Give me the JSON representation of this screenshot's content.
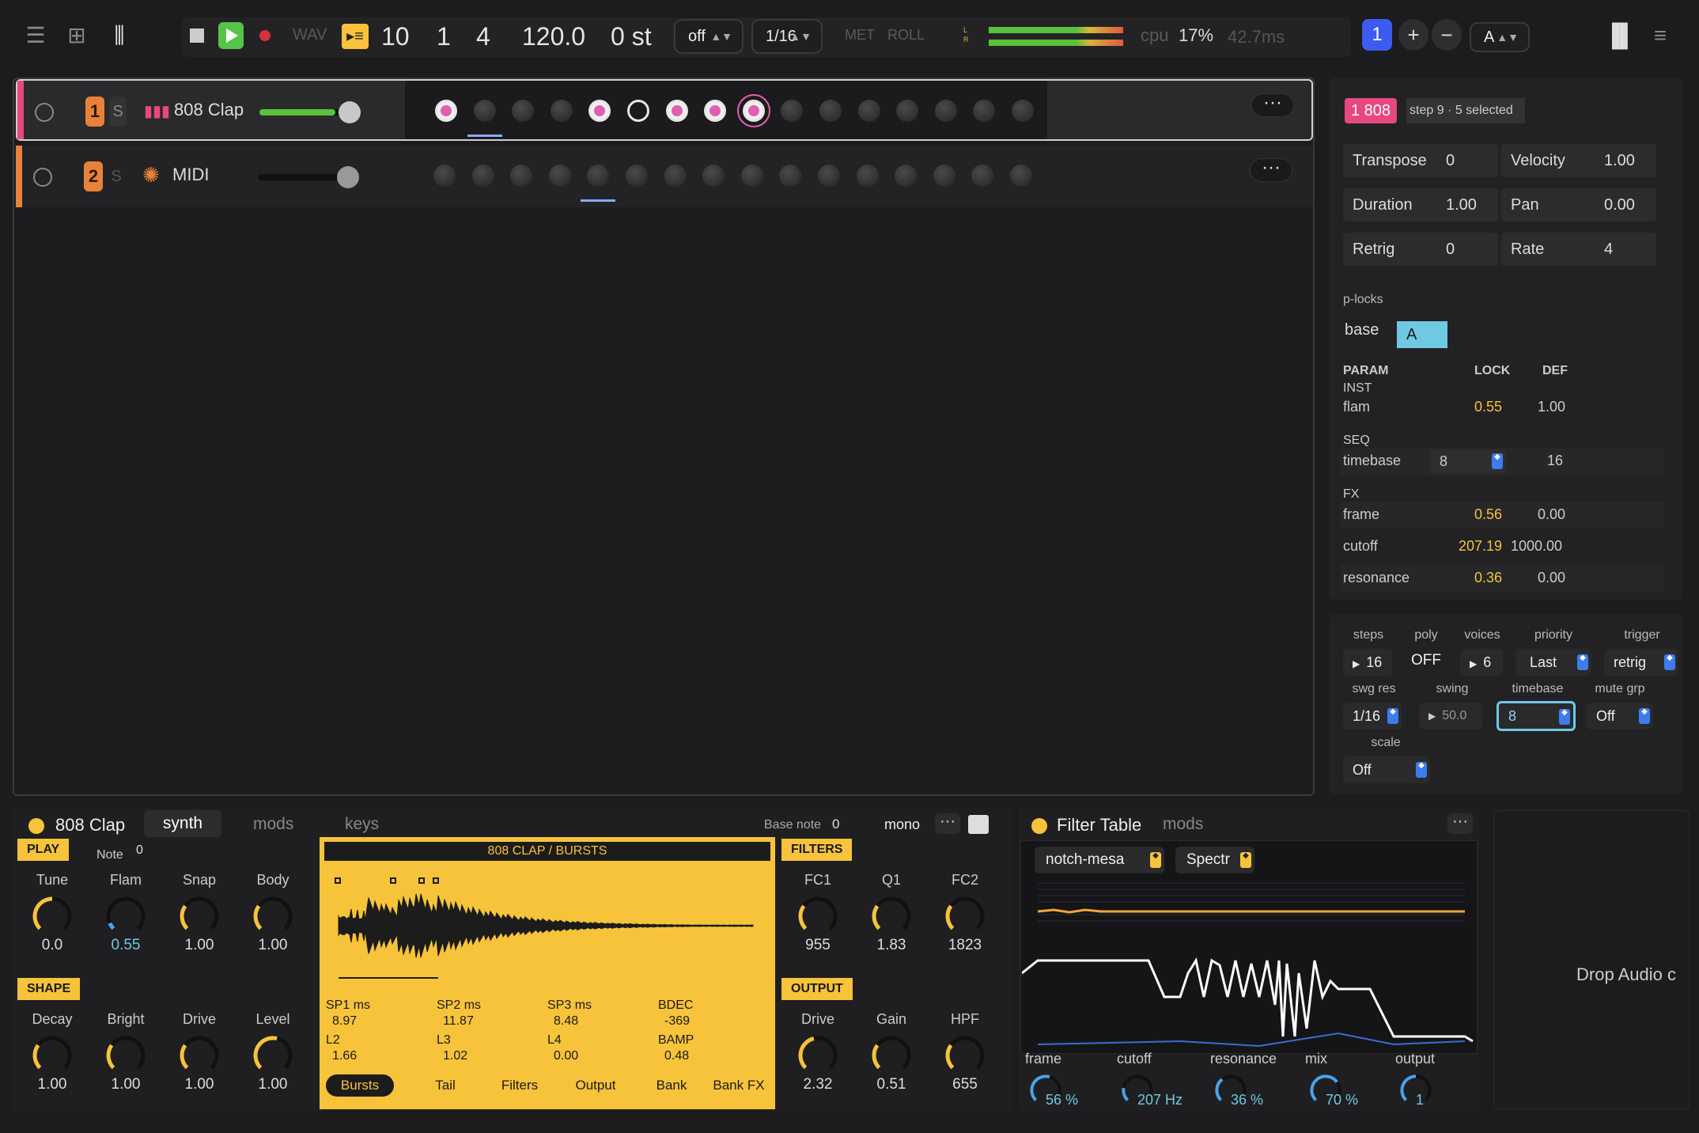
{
  "transport": {
    "wav": "WAV",
    "bar": "10",
    "beat": "1",
    "sub": "4",
    "tempo": "120.0",
    "semi": "0 st",
    "quant": "off",
    "grid": "1/16",
    "met": "MET",
    "roll": "ROLL",
    "cpu_label": "cpu",
    "cpu": "17%",
    "latency": "42.7ms",
    "pattern_num": "1",
    "plus": "+",
    "minus": "−",
    "bank": "A",
    "meter_l": "L",
    "meter_r": "R"
  },
  "tracks": [
    {
      "num": "1",
      "solo": "S",
      "name": "808 Clap",
      "color": "#e8487f",
      "fader": 0.7
    },
    {
      "num": "2",
      "solo": "S",
      "name": "MIDI",
      "color": "#e8823a",
      "fader": 0.78
    }
  ],
  "inspector": {
    "badge": "1 808",
    "step": "step 9",
    "selected": "· 5 selected",
    "params": [
      {
        "label": "Transpose",
        "value": "0"
      },
      {
        "label": "Velocity",
        "value": "1.00"
      },
      {
        "label": "Duration",
        "value": "1.00"
      },
      {
        "label": "Pan",
        "value": "0.00"
      },
      {
        "label": "Retrig",
        "value": "0"
      },
      {
        "label": "Rate",
        "value": "4"
      }
    ],
    "plocks_title": "p-locks",
    "base": "base",
    "base_val": "A",
    "col_param": "PARAM",
    "col_lock": "LOCK",
    "col_def": "DEF",
    "inst": "INST",
    "flam": "flam",
    "flam_lock": "0.55",
    "flam_def": "1.00",
    "seq": "SEQ",
    "timebase": "timebase",
    "timebase_lock": "8",
    "timebase_def": "16",
    "fx": "FX",
    "frame": "frame",
    "frame_lock": "0.56",
    "frame_def": "0.00",
    "cutoff": "cutoff",
    "cutoff_lock": "207.19",
    "cutoff_def": "1000.00",
    "resonance": "resonance",
    "res_lock": "0.36",
    "res_def": "0.00"
  },
  "track_settings": {
    "steps_l": "steps",
    "steps": "16",
    "poly_l": "poly",
    "poly": "OFF",
    "voices_l": "voices",
    "voices": "6",
    "priority_l": "priority",
    "priority": "Last",
    "trigger_l": "trigger",
    "trigger": "retrig",
    "swgres_l": "swg res",
    "swgres": "1/16",
    "swing_l": "swing",
    "swing": "50.0",
    "timebase_l": "timebase",
    "timebase": "8",
    "mutegrp_l": "mute grp",
    "mutegrp": "Off",
    "scale_l": "scale",
    "scale": "Off"
  },
  "instrument": {
    "name": "808 Clap",
    "tab_synth": "synth",
    "tab_mods": "mods",
    "tab_keys": "keys",
    "base_note_l": "Base note",
    "base_note": "0",
    "mono": "mono",
    "play": "PLAY",
    "note_l": "Note",
    "note": "0",
    "play_knobs": [
      {
        "l": "Tune",
        "v": "0.0"
      },
      {
        "l": "Flam",
        "v": "0.55"
      },
      {
        "l": "Snap",
        "v": "1.00"
      },
      {
        "l": "Body",
        "v": "1.00"
      }
    ],
    "shape": "SHAPE",
    "shape_knobs": [
      {
        "l": "Decay",
        "v": "1.00"
      },
      {
        "l": "Bright",
        "v": "1.00"
      },
      {
        "l": "Drive",
        "v": "1.00"
      },
      {
        "l": "Level",
        "v": "1.00"
      }
    ],
    "wave_title": "808 CLAP / BURSTS",
    "w_params": [
      {
        "l": "SP1 ms",
        "v": "8.97"
      },
      {
        "l": "SP2 ms",
        "v": "11.87"
      },
      {
        "l": "SP3 ms",
        "v": "8.48"
      },
      {
        "l": "BDEC",
        "v": "-369"
      },
      {
        "l": "L2",
        "v": "1.66"
      },
      {
        "l": "L3",
        "v": "1.02"
      },
      {
        "l": "L4",
        "v": "0.00"
      },
      {
        "l": "BAMP",
        "v": "0.48"
      }
    ],
    "w_tabs": [
      "Bursts",
      "Tail",
      "Filters",
      "Output",
      "Bank",
      "Bank FX"
    ],
    "filters": "FILTERS",
    "filter_knobs": [
      {
        "l": "FC1",
        "v": "955"
      },
      {
        "l": "Q1",
        "v": "1.83"
      },
      {
        "l": "FC2",
        "v": "1823"
      }
    ],
    "output": "OUTPUT",
    "output_knobs": [
      {
        "l": "Drive",
        "v": "2.32"
      },
      {
        "l": "Gain",
        "v": "0.51"
      },
      {
        "l": "HPF",
        "v": "655"
      }
    ]
  },
  "filter_table": {
    "title": "Filter Table",
    "mods": "mods",
    "preset": "notch-mesa",
    "mode": "Spectr",
    "knobs": [
      {
        "l": "frame",
        "v": "56 %"
      },
      {
        "l": "cutoff",
        "v": "207 Hz"
      },
      {
        "l": "resonance",
        "v": "36 %"
      },
      {
        "l": "mix",
        "v": "70 %"
      },
      {
        "l": "output",
        "v": "1"
      }
    ]
  },
  "drop": "Drop Audio c",
  "more": "···"
}
